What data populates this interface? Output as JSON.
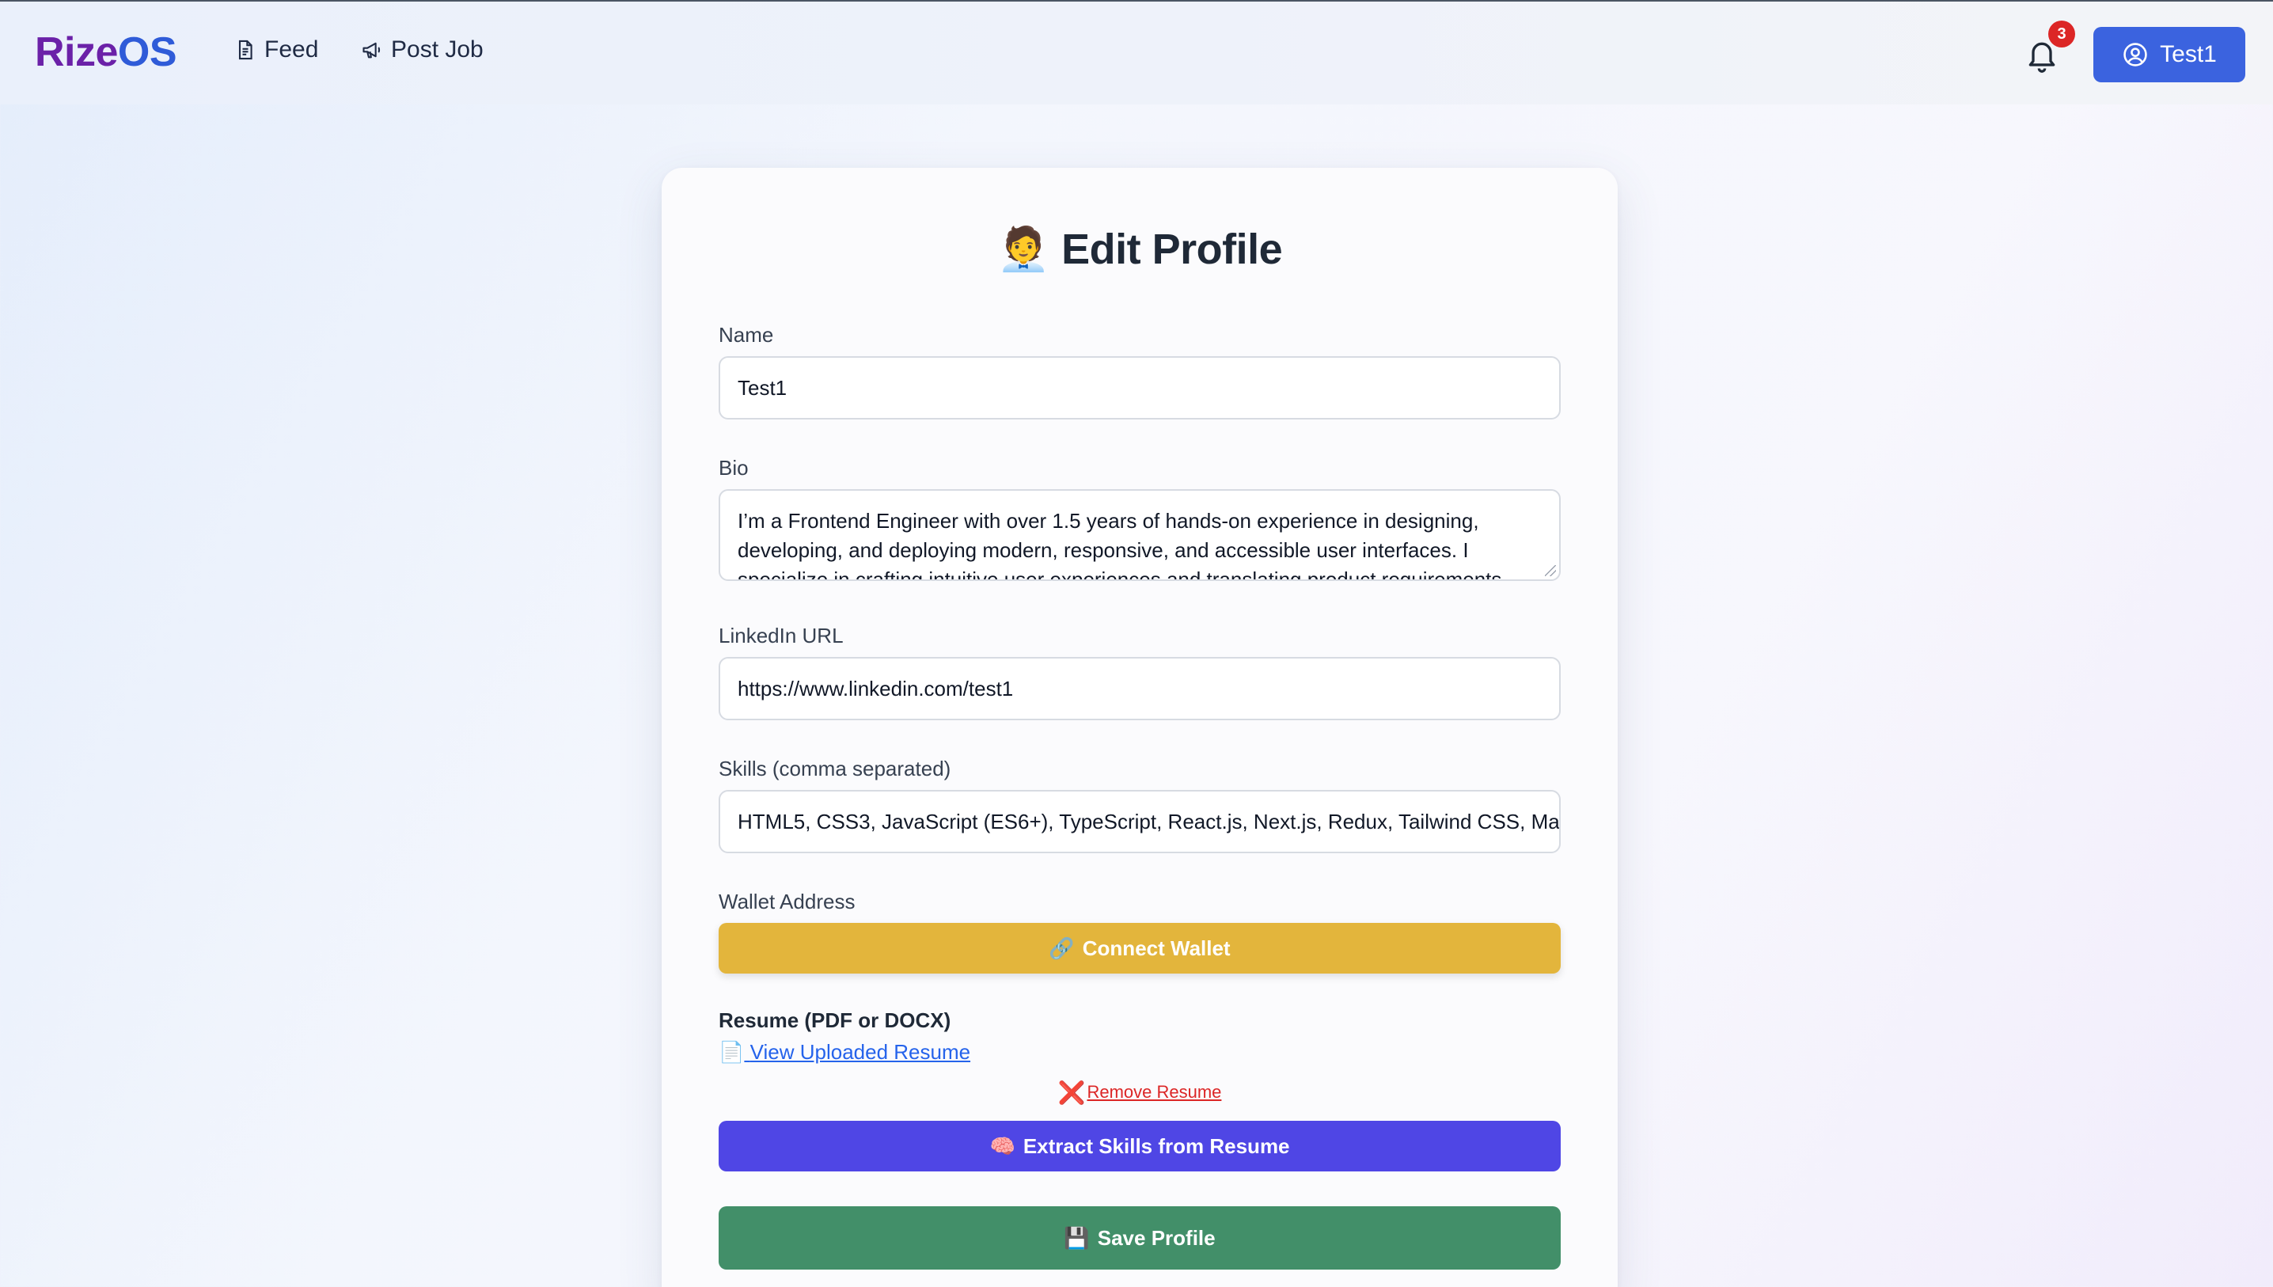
{
  "header": {
    "logo_part1": "Rize",
    "logo_part2": "OS",
    "nav": [
      {
        "label": "Feed",
        "icon": "document-icon"
      },
      {
        "label": "Post Job",
        "icon": "megaphone-icon"
      }
    ],
    "notification_count": "3",
    "user_label": "Test1"
  },
  "form": {
    "title": "Edit Profile",
    "title_emoji": "🧑‍💼",
    "name_label": "Name",
    "name_value": "Test1",
    "bio_label": "Bio",
    "bio_value": "I’m a Frontend Engineer with over 1.5 years of hands-on experience in designing, developing, and deploying modern, responsive, and accessible user interfaces. I specialize in crafting intuitive user experiences and translating product requirements",
    "linkedin_label": "LinkedIn URL",
    "linkedin_value": "https://www.linkedin.com/test1",
    "skills_label": "Skills (comma separated)",
    "skills_value": "HTML5, CSS3, JavaScript (ES6+), TypeScript, React.js, Next.js, Redux, Tailwind CSS, Ma",
    "wallet_label": "Wallet Address",
    "connect_wallet": "Connect Wallet",
    "connect_wallet_emoji": "🔗",
    "resume_label": "Resume (PDF or DOCX)",
    "view_resume": "View Uploaded Resume",
    "view_resume_emoji": "📄",
    "remove_resume": "Remove Resume",
    "remove_resume_emoji": "❌",
    "extract_skills": "Extract Skills from Resume",
    "extract_skills_emoji": "🧠",
    "save_profile": "Save Profile",
    "save_profile_emoji": "💾"
  },
  "colors": {
    "brand_purple": "#6b21a8",
    "brand_blue": "#2f5bd8",
    "user_button": "#3b63df",
    "wallet_button": "#e3b53c",
    "extract_button": "#4f46e5",
    "save_button": "#428f69",
    "badge": "#dc2626"
  }
}
